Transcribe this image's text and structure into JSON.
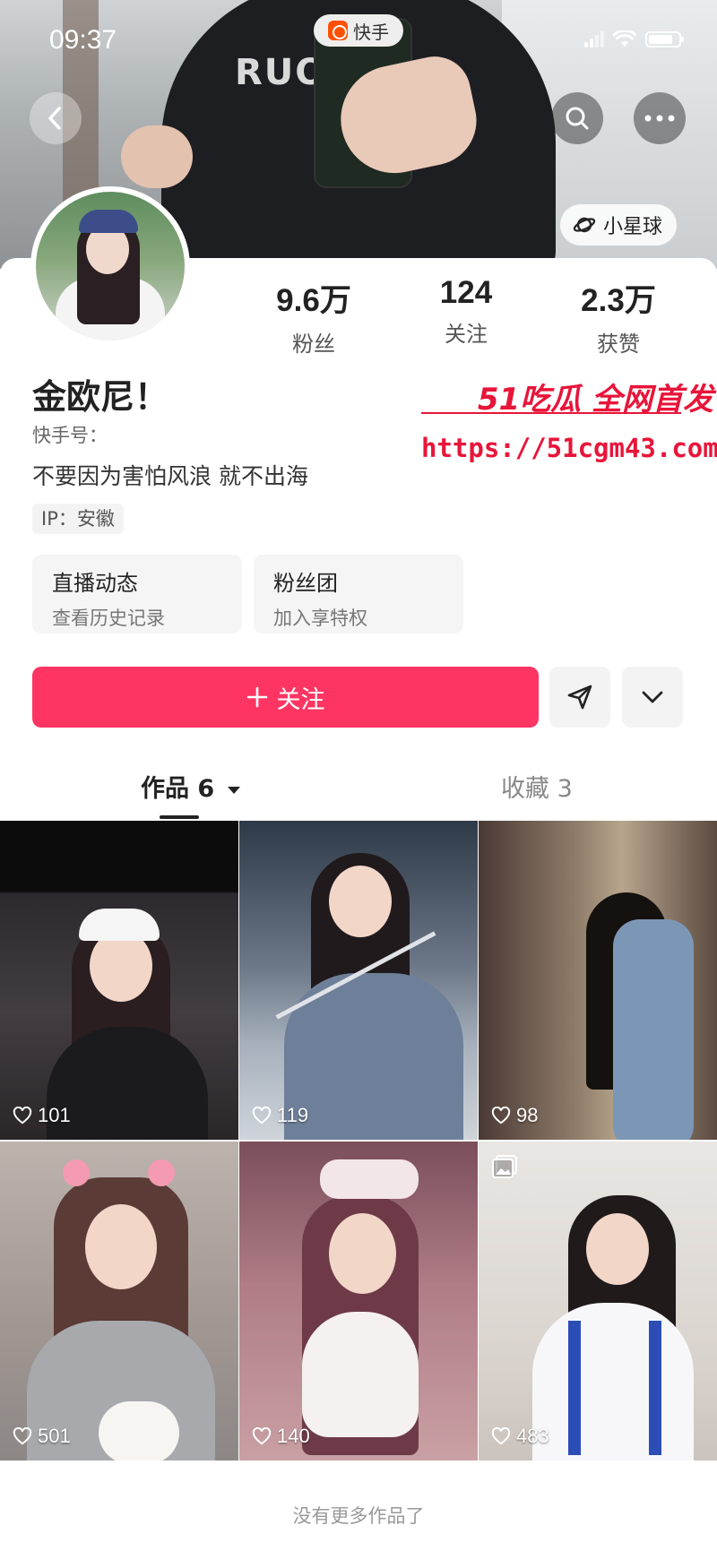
{
  "status_bar": {
    "time": "09:37",
    "app_name": "快手",
    "battery_level": 0.8
  },
  "header": {
    "planet_chip": "小星球"
  },
  "profile": {
    "stats": [
      {
        "value": "9.6万",
        "label": "粉丝"
      },
      {
        "value": "124",
        "label": "关注"
      },
      {
        "value": "2.3万",
        "label": "获赞"
      }
    ],
    "nickname": "金欧尼！",
    "kuaishou_id_label": "快手号：",
    "bio": "不要因为害怕风浪 就不出海",
    "ip": "IP：安徽"
  },
  "watermark": {
    "brand": "51吃瓜 全网首发",
    "url": "https://51cgm43.com"
  },
  "features": [
    {
      "title": "直播动态",
      "subtitle": "查看历史记录"
    },
    {
      "title": "粉丝团",
      "subtitle": "加入享特权"
    }
  ],
  "actions": {
    "follow_label": "关注"
  },
  "tabs": [
    {
      "label": "作品 6",
      "active": true
    },
    {
      "label": "收藏 3",
      "active": false
    }
  ],
  "videos": [
    {
      "likes": "101",
      "album": false
    },
    {
      "likes": "119",
      "album": false
    },
    {
      "likes": "98",
      "album": false
    },
    {
      "likes": "501",
      "album": false
    },
    {
      "likes": "140",
      "album": false
    },
    {
      "likes": "483",
      "album": true
    }
  ],
  "footer": {
    "end_text": "没有更多作品了"
  },
  "colors": {
    "accent": "#fe3562",
    "watermark": "#e8153a"
  }
}
